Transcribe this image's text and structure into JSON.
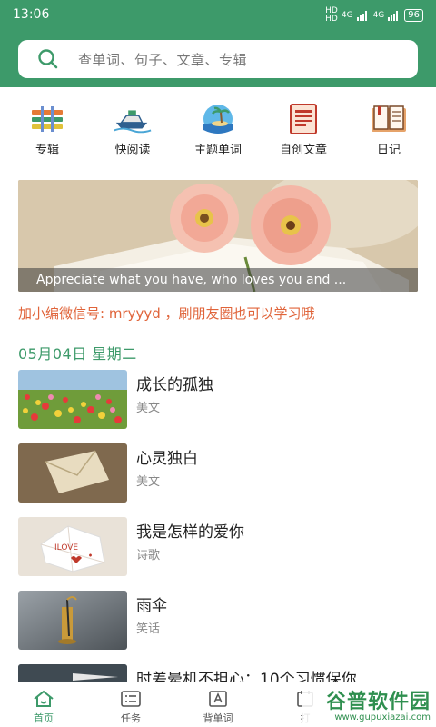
{
  "status_bar": {
    "time": "13:06",
    "network_1": "HD B",
    "network_2": "4G",
    "network_3": "4G",
    "battery": "96"
  },
  "search": {
    "placeholder": "查单词、句子、文章、专辑"
  },
  "quick_actions": [
    {
      "label": "专辑",
      "icon": "album-icon"
    },
    {
      "label": "快阅读",
      "icon": "speedboat-icon"
    },
    {
      "label": "主题单词",
      "icon": "island-icon"
    },
    {
      "label": "自创文章",
      "icon": "document-icon"
    },
    {
      "label": "日记",
      "icon": "diary-icon"
    }
  ],
  "banner": {
    "caption": "Appreciate what you have, who loves you and ..."
  },
  "notice": "加小编微信号: mryyyd ，刷朋友圈也可以学习哦",
  "date_header": "05月04日 星期二",
  "articles": [
    {
      "title": "成长的孤独",
      "category": "美文"
    },
    {
      "title": "心灵独白",
      "category": "美文"
    },
    {
      "title": "我是怎样的爱你",
      "category": "诗歌"
    },
    {
      "title": "雨伞",
      "category": "笑话"
    },
    {
      "title": "时差晕机不担心：10个习惯保你",
      "category": ""
    }
  ],
  "tabs": [
    {
      "label": "首页",
      "icon": "home-icon",
      "active": true
    },
    {
      "label": "任务",
      "icon": "task-icon"
    },
    {
      "label": "背单词",
      "icon": "vocabulary-icon"
    },
    {
      "label": "打",
      "icon": "checkin-icon"
    }
  ],
  "watermark": {
    "title": "谷普软件园",
    "url": "www.gupuxiazai.com"
  },
  "colors": {
    "primary": "#3d9a6a",
    "notice": "#e0643a"
  }
}
